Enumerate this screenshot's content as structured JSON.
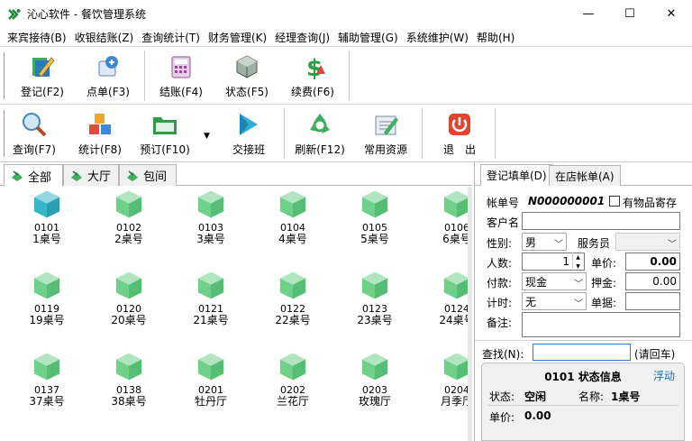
{
  "window": {
    "title": "沁心软件 - 餐饮管理系统",
    "minimize": "—",
    "maximize": "☐",
    "close": "✕"
  },
  "menu": [
    "来宾接待(B)",
    "收银结账(Z)",
    "查询统计(T)",
    "财务管理(K)",
    "经理查询(J)",
    "辅助管理(G)",
    "系统维护(W)",
    "帮助(H)"
  ],
  "toolbar1": [
    {
      "label": "登记(F2)",
      "icon": "register-icon"
    },
    {
      "label": "点单(F3)",
      "icon": "order-icon"
    },
    {
      "label": "结账(F4)",
      "icon": "checkout-icon"
    },
    {
      "label": "状态(F5)",
      "icon": "status-icon"
    },
    {
      "label": "续费(F6)",
      "icon": "renew-icon"
    }
  ],
  "toolbar2": [
    {
      "label": "查询(F7)",
      "icon": "query-icon"
    },
    {
      "label": "统计(F8)",
      "icon": "stats-icon"
    },
    {
      "label": "预订(F10)",
      "icon": "reserve-icon"
    },
    {
      "label": "交接班",
      "icon": "handover-icon"
    },
    {
      "label": "刷新(F12)",
      "icon": "refresh-icon"
    },
    {
      "label": "常用资源",
      "icon": "resources-icon"
    },
    {
      "label": "退　出",
      "icon": "exit-icon"
    }
  ],
  "left_tabs": [
    "全部",
    "大厅",
    "包间"
  ],
  "tables": [
    {
      "code": "0101",
      "name": "1桌号",
      "selected": true
    },
    {
      "code": "0102",
      "name": "2桌号"
    },
    {
      "code": "0103",
      "name": "3桌号"
    },
    {
      "code": "0104",
      "name": "4桌号"
    },
    {
      "code": "0105",
      "name": "5桌号"
    },
    {
      "code": "0106",
      "name": "6桌号"
    },
    {
      "code": "0119",
      "name": "19桌号"
    },
    {
      "code": "0120",
      "name": "20桌号"
    },
    {
      "code": "0121",
      "name": "21桌号"
    },
    {
      "code": "0122",
      "name": "22桌号"
    },
    {
      "code": "0123",
      "name": "23桌号"
    },
    {
      "code": "0124",
      "name": "24桌号"
    },
    {
      "code": "0137",
      "name": "37桌号"
    },
    {
      "code": "0138",
      "name": "38桌号"
    },
    {
      "code": "0201",
      "name": "牡丹厅"
    },
    {
      "code": "0202",
      "name": "兰花厅"
    },
    {
      "code": "0203",
      "name": "玫瑰厅"
    },
    {
      "code": "0204",
      "name": "月季厅"
    }
  ],
  "right_tabs": [
    "登记填单(D)",
    "在店帐单(A)"
  ],
  "form": {
    "account_label": "帐单号",
    "account_value": "N000000001",
    "storage_label": "有物品寄存",
    "customer_label": "客户名",
    "customer_value": "",
    "gender_label": "性别:",
    "gender_value": "男",
    "waiter_label": "服务员",
    "waiter_value": "",
    "people_label": "人数:",
    "people_value": "1",
    "price_label": "单价:",
    "price_value": "0.00",
    "pay_label": "付款:",
    "pay_value": "现金",
    "deposit_label": "押金:",
    "deposit_value": "0.00",
    "timing_label": "计时:",
    "timing_value": "无",
    "voucher_label": "单据:",
    "voucher_value": "",
    "remark_label": "备注:",
    "remark_value": ""
  },
  "search": {
    "label": "查找(N):",
    "value": "",
    "hint": "(请回车)"
  },
  "status_panel": {
    "title": "0101 状态信息",
    "float": "浮动",
    "state_label": "状态:",
    "state_value": "空闲",
    "name_label": "名称:",
    "name_value": "1桌号",
    "price_label": "单价:",
    "price_value": "0.00"
  },
  "colors": {
    "cube": "#6fd08a",
    "cube_dark": "#3fae62",
    "selected_cube": "#38b6c9",
    "link": "#1b6ec2"
  }
}
